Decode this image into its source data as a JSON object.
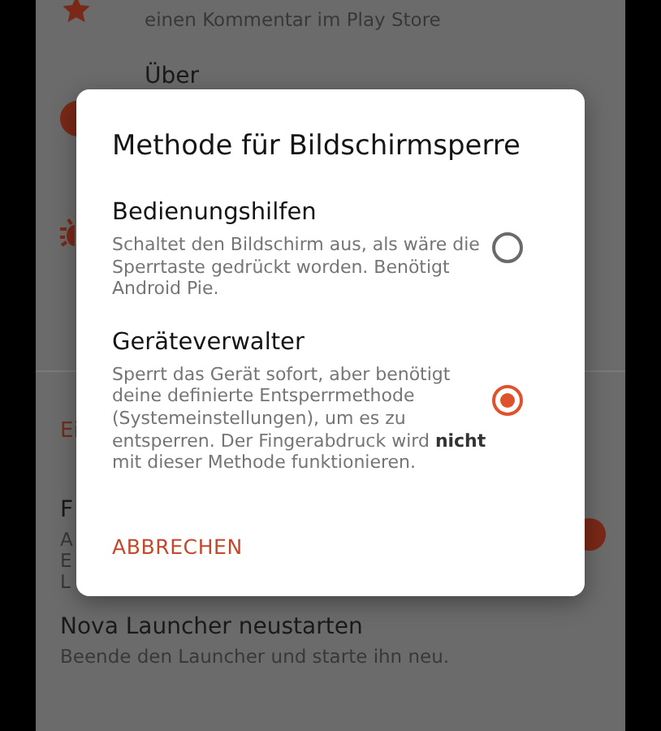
{
  "settings": {
    "rate": {
      "description": "einen Kommentar im Play Store"
    },
    "about": {
      "title": "Über"
    },
    "section_header": "Ei",
    "rows": [
      {
        "kind": "toggle",
        "title": "F",
        "description_lines": [
          "A",
          "E",
          "L"
        ],
        "on": true
      },
      {
        "kind": "plain",
        "title": "Nova Launcher neustarten",
        "description_lines": [
          "Beende den Launcher und starte ihn neu."
        ]
      }
    ]
  },
  "dialog": {
    "title": "Methode für Bildschirmsperre",
    "options": [
      {
        "title": "Bedienungshilfen",
        "description": "Schaltet den Bildschirm aus, als wäre die Sperrtaste gedrückt worden. Benötigt Android Pie.",
        "selected": false
      },
      {
        "title": "Geräteverwalter",
        "description": "Sperrt das Gerät sofort, aber benötigt deine definierte Entsperrmethode (Systemeinstellungen), um es zu entsperren. Der Fingerabdruck wird **nicht** mit dieser Methode funktionieren.",
        "selected": true
      }
    ],
    "cancel": "ABBRECHEN"
  }
}
